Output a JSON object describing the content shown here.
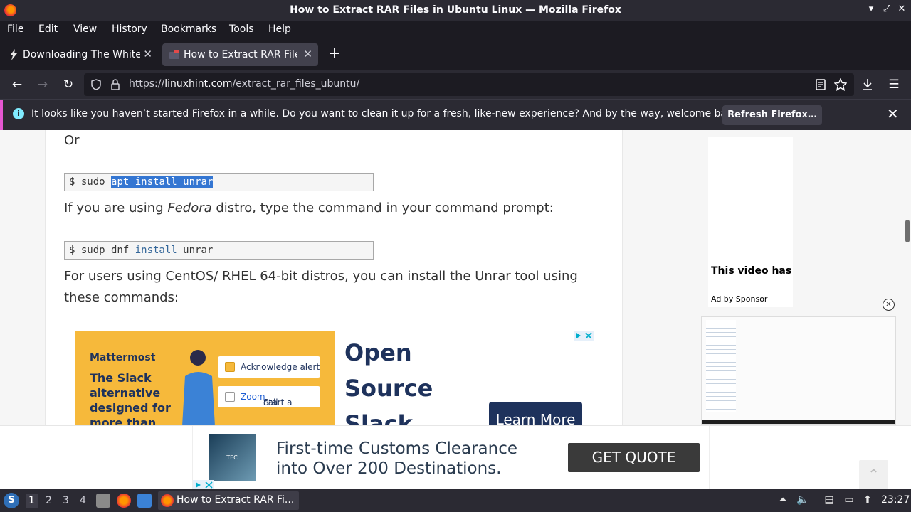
{
  "window": {
    "title": "How to Extract RAR Files in Ubuntu Linux — Mozilla Firefox",
    "minimize": "▾",
    "restore": "⤢",
    "close": "✕"
  },
  "menu": [
    "File",
    "Edit",
    "View",
    "History",
    "Bookmarks",
    "Tools",
    "Help"
  ],
  "tabs": [
    {
      "label": "Downloading The White Hat",
      "active": false,
      "icon": "bolt-icon"
    },
    {
      "label": "How to Extract RAR Files in Ubuntu",
      "active": true,
      "icon": "linuxhint-favicon"
    }
  ],
  "new_tab": "+",
  "nav": {
    "url_prefix": "https://",
    "url_domain": "linuxhint.com",
    "url_path": "/extract_rar_files_ubuntu/"
  },
  "infobar": {
    "message": "It looks like you haven’t started Firefox in a while. Do you want to clean it up for a fresh, like-new experience? And by the way, welcome back!",
    "button": "Refresh Firefox…",
    "close": "✕"
  },
  "article": {
    "or_text": "Or",
    "code1_prompt": "$ sudo ",
    "code1_selected": "apt install unrar",
    "fedora_pre": "If you are using ",
    "fedora_em": "Fedora",
    "fedora_post": " distro, type the command in your command prompt:",
    "code2_pre": "$ sudp dnf ",
    "code2_kw": "install",
    "code2_post": " unrar",
    "centos_line1": "For users using CentOS/ RHEL 64-bit distros, you can install the Unrar tool using",
    "centos_line2": "these commands:"
  },
  "banner_ad": {
    "brand": "Mattermost",
    "tagline": "The Slack alternative designed for more than messaging",
    "card1": "Acknowledge alert",
    "card2_pre": "Start a ",
    "card2_link": "Zoom",
    "card2_post": " call",
    "headline1": "Open",
    "headline2": "Source",
    "headline3": "Slack",
    "cta": "Learn More"
  },
  "sidebar_ad": {
    "video_title": "This video has",
    "sponsor": "Ad by Sponsor"
  },
  "sticky_ad": {
    "headline1": "First-time Customs Clearance",
    "headline2": "into Over 200 Destinations.",
    "cta": "GET QUOTE",
    "thumb_text": "TEC"
  },
  "taskbar": {
    "workspaces": [
      "1",
      "2",
      "3",
      "4"
    ],
    "active_task": "How to Extract RAR Fi...",
    "clock": "23:27"
  },
  "colors": {
    "accent": "#e557d2",
    "selection": "#3476d2",
    "ad_yellow": "#f6b93b",
    "ad_navy": "#1e325c"
  }
}
